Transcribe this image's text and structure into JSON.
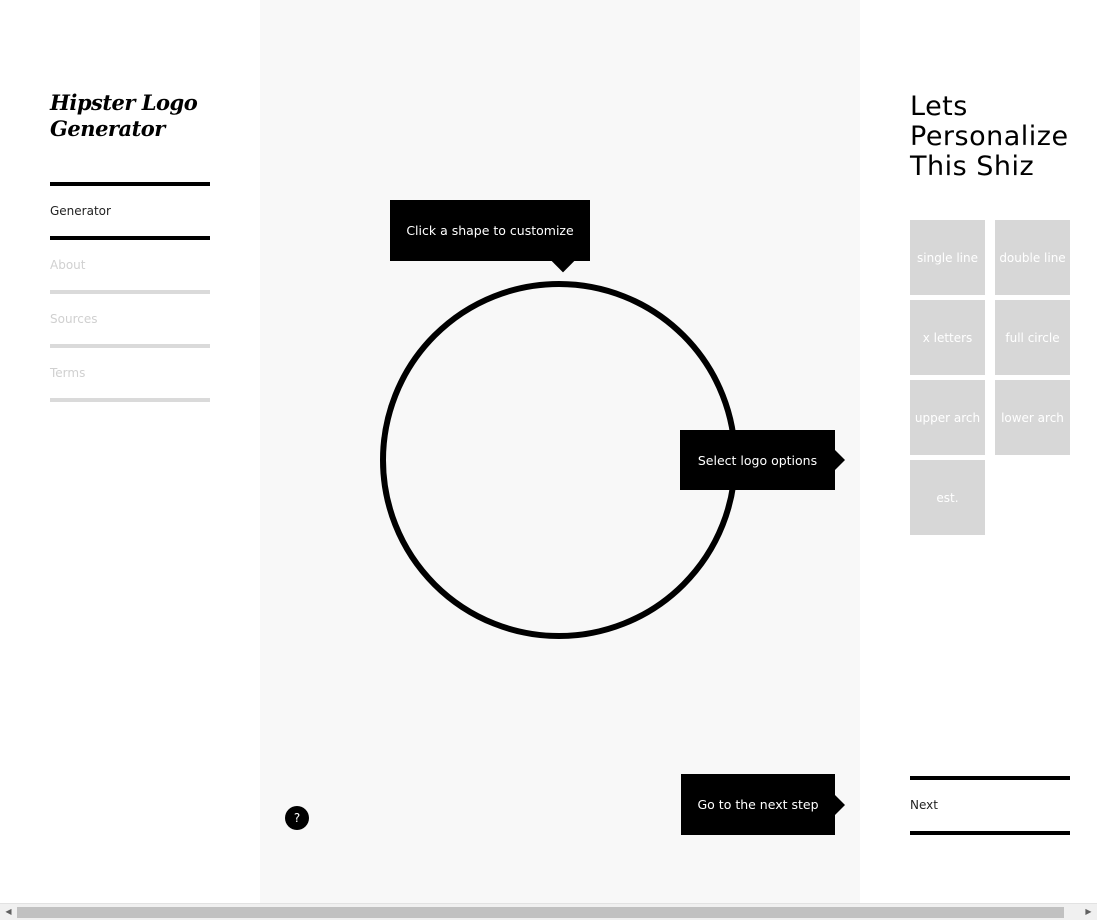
{
  "app": {
    "logo_title": "Hipster Logo Generator"
  },
  "nav": {
    "items": [
      {
        "label": "Generator",
        "active": true
      },
      {
        "label": "About",
        "active": false
      },
      {
        "label": "Sources",
        "active": false
      },
      {
        "label": "Terms",
        "active": false
      }
    ]
  },
  "canvas": {
    "shape_tip": "Click a shape to customize",
    "options_tip": "Select logo options",
    "next_tip": "Go to the next step",
    "help_label": "?",
    "shape": "full circle"
  },
  "panel": {
    "title": "Lets Personalize This Shiz",
    "options": [
      "single line",
      "double line",
      "x letters",
      "full circle",
      "upper arch",
      "lower arch",
      "est."
    ],
    "next_label": "Next"
  },
  "colors": {
    "accent": "#000000",
    "canvas_bg": "#f8f8f8",
    "option_bg": "#d7d7d7",
    "inactive_text": "#d0d0d0"
  }
}
